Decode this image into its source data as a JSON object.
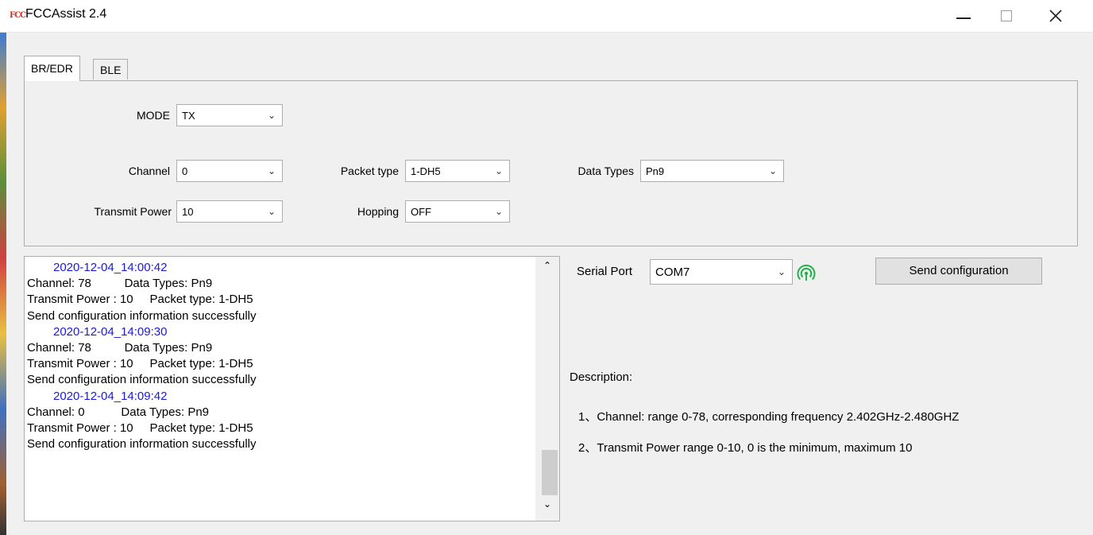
{
  "window": {
    "icon_text": "FCC",
    "title": "FCCAssist 2.4"
  },
  "tabs": [
    {
      "label": "BR/EDR",
      "active": true
    },
    {
      "label": "BLE",
      "active": false
    }
  ],
  "config": {
    "mode": {
      "label": "MODE",
      "value": "TX"
    },
    "channel": {
      "label": "Channel",
      "value": "0"
    },
    "packet_type": {
      "label": "Packet type",
      "value": "1-DH5"
    },
    "data_types": {
      "label": "Data Types",
      "value": "Pn9"
    },
    "transmit_power": {
      "label": "Transmit Power",
      "value": "10"
    },
    "hopping": {
      "label": "Hopping",
      "value": "OFF"
    }
  },
  "log": {
    "entries": [
      {
        "timestamp": "2020-12-04_14:00:42",
        "line1": "Channel: 78          Data Types: Pn9",
        "line2": "Transmit Power : 10     Packet type: 1-DH5",
        "line3": "Send configuration information successfully"
      },
      {
        "timestamp": "2020-12-04_14:09:30",
        "line1": "Channel: 78          Data Types: Pn9",
        "line2": "Transmit Power : 10     Packet type: 1-DH5",
        "line3": "Send configuration information successfully"
      },
      {
        "timestamp": "2020-12-04_14:09:42",
        "line1": "Channel: 0           Data Types: Pn9",
        "line2": "Transmit Power : 10     Packet type: 1-DH5",
        "line3": "Send configuration information successfully"
      }
    ]
  },
  "serial": {
    "label": "Serial Port",
    "value": "COM7",
    "status_color": "#22b14c"
  },
  "send_button": "Send configuration",
  "description": {
    "heading": "Description:",
    "items": [
      "1、Channel: range 0-78, corresponding frequency 2.402GHz-2.480GHZ",
      "2、Transmit Power  range 0-10, 0 is the minimum, maximum 10"
    ]
  }
}
